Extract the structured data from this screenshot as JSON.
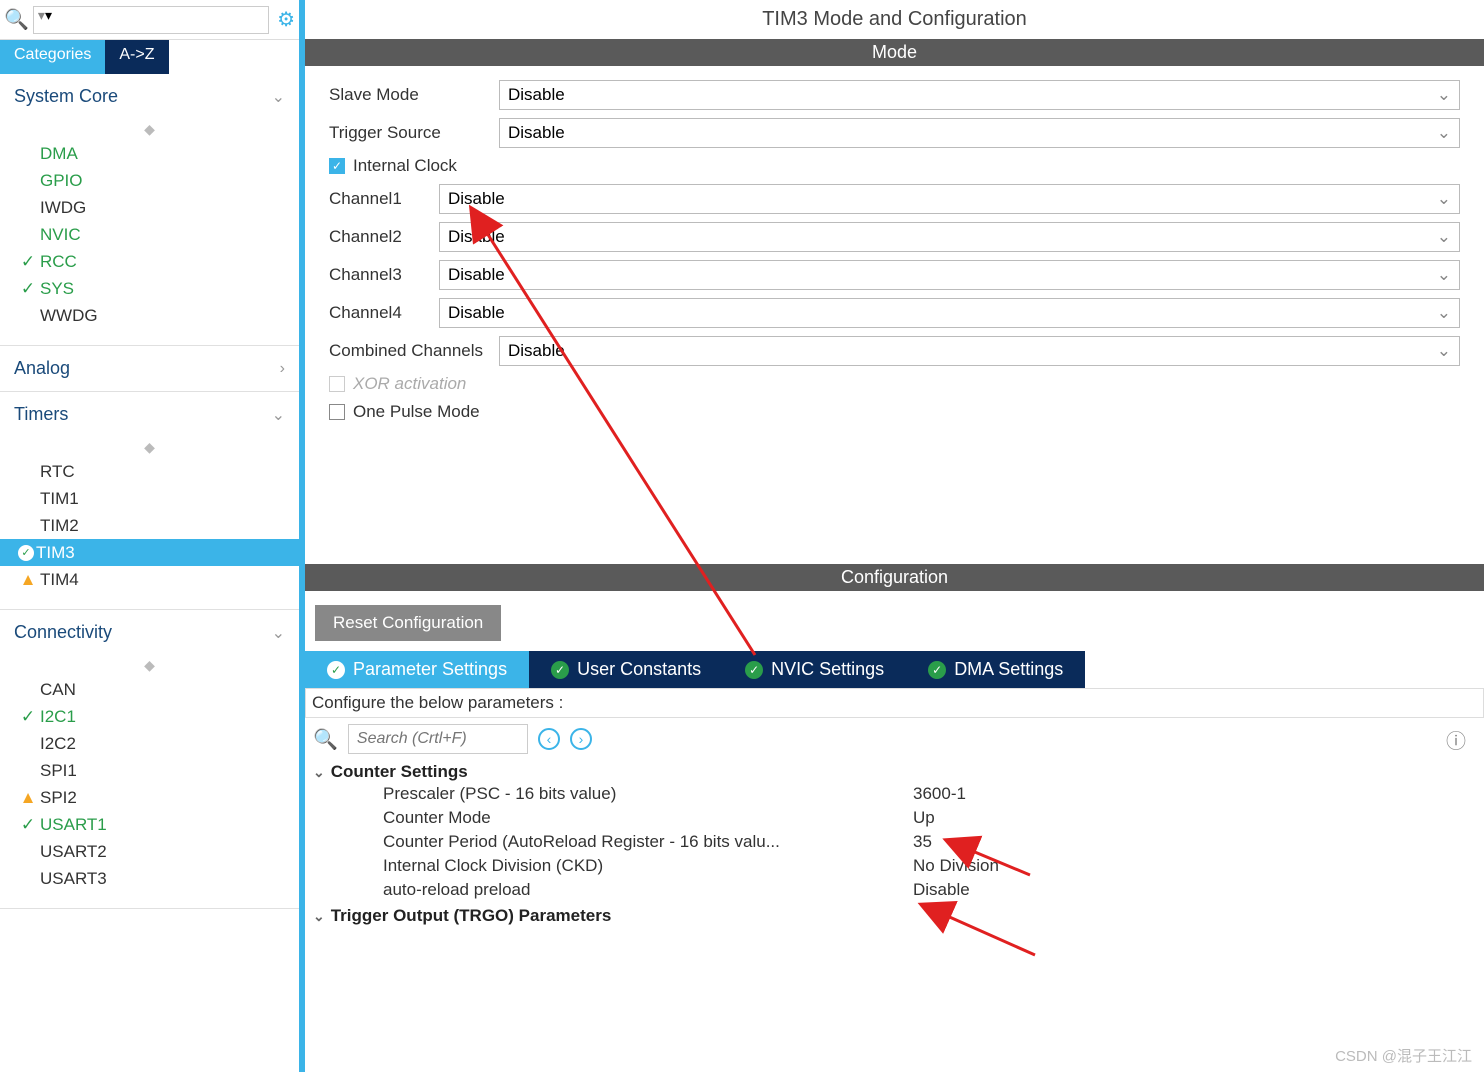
{
  "sidebar": {
    "tabs": {
      "categories": "Categories",
      "az": "A->Z"
    },
    "sections": [
      {
        "name": "System Core",
        "expanded": true,
        "items": [
          {
            "label": "DMA",
            "style": "green"
          },
          {
            "label": "GPIO",
            "style": "green"
          },
          {
            "label": "IWDG",
            "style": ""
          },
          {
            "label": "NVIC",
            "style": "green"
          },
          {
            "label": "RCC",
            "style": "green",
            "icon": "check"
          },
          {
            "label": "SYS",
            "style": "green",
            "icon": "check"
          },
          {
            "label": "WWDG",
            "style": ""
          }
        ]
      },
      {
        "name": "Analog",
        "expanded": false,
        "items": []
      },
      {
        "name": "Timers",
        "expanded": true,
        "items": [
          {
            "label": "RTC",
            "style": ""
          },
          {
            "label": "TIM1",
            "style": ""
          },
          {
            "label": "TIM2",
            "style": ""
          },
          {
            "label": "TIM3",
            "style": "",
            "icon": "check-circle",
            "selected": true
          },
          {
            "label": "TIM4",
            "style": "",
            "icon": "warn"
          }
        ]
      },
      {
        "name": "Connectivity",
        "expanded": true,
        "items": [
          {
            "label": "CAN",
            "style": ""
          },
          {
            "label": "I2C1",
            "style": "green",
            "icon": "check"
          },
          {
            "label": "I2C2",
            "style": ""
          },
          {
            "label": "SPI1",
            "style": ""
          },
          {
            "label": "SPI2",
            "style": "",
            "icon": "warn"
          },
          {
            "label": "USART1",
            "style": "green",
            "icon": "check"
          },
          {
            "label": "USART2",
            "style": ""
          },
          {
            "label": "USART3",
            "style": ""
          }
        ]
      }
    ]
  },
  "main": {
    "title": "TIM3 Mode and Configuration",
    "mode_bar": "Mode",
    "config_bar": "Configuration",
    "mode": {
      "slave_mode": {
        "label": "Slave Mode",
        "value": "Disable"
      },
      "trigger_source": {
        "label": "Trigger Source",
        "value": "Disable"
      },
      "internal_clock": {
        "label": "Internal Clock",
        "checked": true
      },
      "channel1": {
        "label": "Channel1",
        "value": "Disable"
      },
      "channel2": {
        "label": "Channel2",
        "value": "Disable"
      },
      "channel3": {
        "label": "Channel3",
        "value": "Disable"
      },
      "channel4": {
        "label": "Channel4",
        "value": "Disable"
      },
      "combined": {
        "label": "Combined Channels",
        "value": "Disable"
      },
      "xor": {
        "label": "XOR activation",
        "checked": false,
        "disabled": true
      },
      "one_pulse": {
        "label": "One Pulse Mode",
        "checked": false
      }
    },
    "reset_btn": "Reset Configuration",
    "cfg_tabs": {
      "parameter": "Parameter Settings",
      "user": "User Constants",
      "nvic": "NVIC Settings",
      "dma": "DMA Settings"
    },
    "instruction": "Configure the below parameters :",
    "search_placeholder": "Search (Crtl+F)",
    "params": {
      "group1": {
        "name": "Counter Settings",
        "rows": [
          {
            "name": "Prescaler (PSC - 16 bits value)",
            "value": "3600-1"
          },
          {
            "name": "Counter Mode",
            "value": "Up"
          },
          {
            "name": "Counter Period (AutoReload Register - 16 bits valu...",
            "value": "35"
          },
          {
            "name": "Internal Clock Division (CKD)",
            "value": "No Division"
          },
          {
            "name": "auto-reload preload",
            "value": "Disable"
          }
        ]
      },
      "group2": {
        "name": "Trigger Output (TRGO) Parameters"
      }
    }
  },
  "watermark": "CSDN @混子王江江"
}
